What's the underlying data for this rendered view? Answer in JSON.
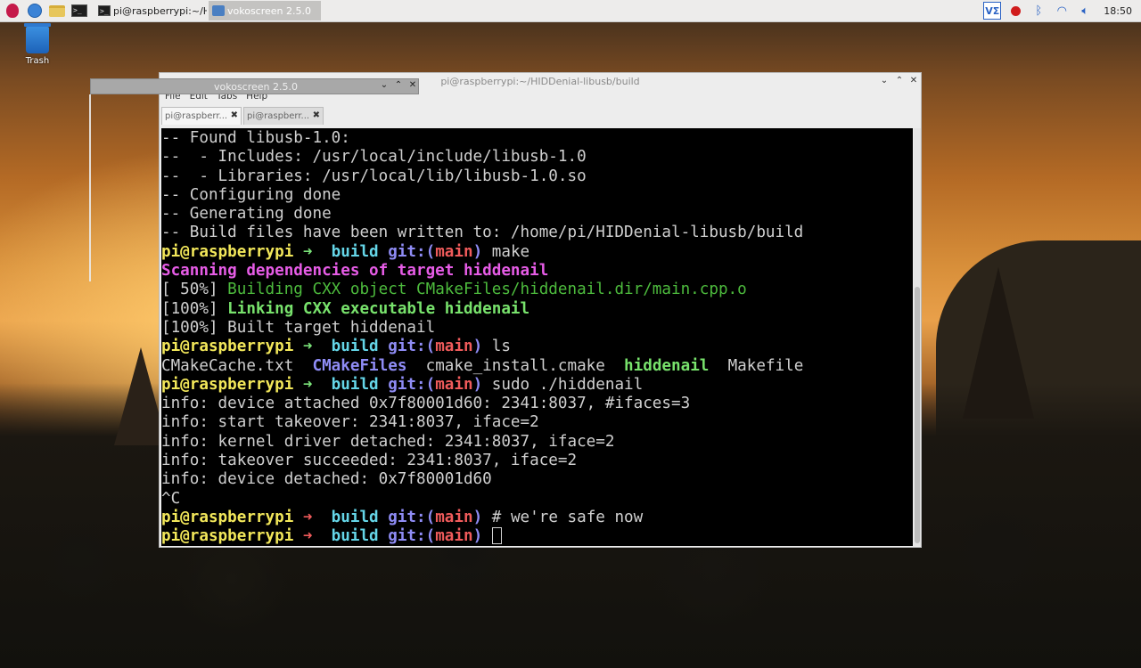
{
  "taskbar": {
    "tasks": [
      {
        "label": "pi@raspberrypi:~/HID"
      },
      {
        "label": "vokoscreen 2.5.0"
      }
    ],
    "tray": {
      "vnc_label": "VΣ",
      "clock": "18:50"
    }
  },
  "desktop": {
    "trash_label": "Trash"
  },
  "vokoscreen": {
    "title": "vokoscreen 2.5.0"
  },
  "terminal": {
    "title": "pi@raspberrypi:~/HIDDenial-libusb/build",
    "menu": [
      "File",
      "Edit",
      "Tabs",
      "Help"
    ],
    "tabs": [
      "pi@raspberr...",
      "pi@raspberr..."
    ],
    "lines": [
      [
        {
          "c": "",
          "t": "-- Found libusb-1.0:"
        }
      ],
      [
        {
          "c": "",
          "t": "--  - Includes: /usr/local/include/libusb-1.0"
        }
      ],
      [
        {
          "c": "",
          "t": "--  - Libraries: /usr/local/lib/libusb-1.0.so"
        }
      ],
      [
        {
          "c": "",
          "t": "-- Configuring done"
        }
      ],
      [
        {
          "c": "",
          "t": "-- Generating done"
        }
      ],
      [
        {
          "c": "",
          "t": "-- Build files have been written to: /home/pi/HIDDenial-libusb/build"
        }
      ],
      [
        {
          "c": "y",
          "t": "pi@raspberrypi"
        },
        {
          "c": "gr",
          "t": " ➜  "
        },
        {
          "c": "cy",
          "t": "build"
        },
        {
          "c": "",
          "t": " "
        },
        {
          "c": "bl",
          "t": "git:("
        },
        {
          "c": "rb",
          "t": "main"
        },
        {
          "c": "bl",
          "t": ")"
        },
        {
          "c": "cmd",
          "t": " make"
        }
      ],
      [
        {
          "c": "mg",
          "t": "Scanning dependencies of target hiddenail"
        }
      ],
      [
        {
          "c": "",
          "t": "[ 50%] "
        },
        {
          "c": "dg",
          "t": "Building CXX object CMakeFiles/hiddenail.dir/main.cpp.o"
        }
      ],
      [
        {
          "c": "",
          "t": "[100%] "
        },
        {
          "c": "lg",
          "t": "Linking CXX executable hiddenail"
        }
      ],
      [
        {
          "c": "",
          "t": "[100%] Built target hiddenail"
        }
      ],
      [
        {
          "c": "y",
          "t": "pi@raspberrypi"
        },
        {
          "c": "gr",
          "t": " ➜  "
        },
        {
          "c": "cy",
          "t": "build"
        },
        {
          "c": "",
          "t": " "
        },
        {
          "c": "bl",
          "t": "git:("
        },
        {
          "c": "rb",
          "t": "main"
        },
        {
          "c": "bl",
          "t": ")"
        },
        {
          "c": "cmd",
          "t": " ls"
        }
      ],
      [
        {
          "c": "",
          "t": "CMakeCache.txt  "
        },
        {
          "c": "bl",
          "t": "CMakeFiles"
        },
        {
          "c": "",
          "t": "  cmake_install.cmake  "
        },
        {
          "c": "lg",
          "t": "hiddenail"
        },
        {
          "c": "",
          "t": "  Makefile"
        }
      ],
      [
        {
          "c": "y",
          "t": "pi@raspberrypi"
        },
        {
          "c": "gr",
          "t": " ➜  "
        },
        {
          "c": "cy",
          "t": "build"
        },
        {
          "c": "",
          "t": " "
        },
        {
          "c": "bl",
          "t": "git:("
        },
        {
          "c": "rb",
          "t": "main"
        },
        {
          "c": "bl",
          "t": ")"
        },
        {
          "c": "cmd",
          "t": " sudo ./hiddenail"
        }
      ],
      [
        {
          "c": "",
          "t": "info: device attached 0x7f80001d60: 2341:8037, #ifaces=3"
        }
      ],
      [
        {
          "c": "",
          "t": "info: start takeover: 2341:8037, iface=2"
        }
      ],
      [
        {
          "c": "",
          "t": "info: kernel driver detached: 2341:8037, iface=2"
        }
      ],
      [
        {
          "c": "",
          "t": "info: takeover succeeded: 2341:8037, iface=2"
        }
      ],
      [
        {
          "c": "",
          "t": "info: device detached: 0x7f80001d60"
        }
      ],
      [
        {
          "c": "",
          "t": "^C"
        }
      ],
      [
        {
          "c": "y",
          "t": "pi@raspberrypi"
        },
        {
          "c": "rd",
          "t": " ➜  "
        },
        {
          "c": "cy",
          "t": "build"
        },
        {
          "c": "",
          "t": " "
        },
        {
          "c": "bl",
          "t": "git:("
        },
        {
          "c": "rb",
          "t": "main"
        },
        {
          "c": "bl",
          "t": ")"
        },
        {
          "c": "cmd",
          "t": " # we're safe now"
        }
      ],
      [
        {
          "c": "y",
          "t": "pi@raspberrypi"
        },
        {
          "c": "rd",
          "t": " ➜  "
        },
        {
          "c": "cy",
          "t": "build"
        },
        {
          "c": "",
          "t": " "
        },
        {
          "c": "bl",
          "t": "git:("
        },
        {
          "c": "rb",
          "t": "main"
        },
        {
          "c": "bl",
          "t": ")"
        },
        {
          "c": "cmd",
          "t": " "
        },
        {
          "c": "cursor",
          "t": ""
        }
      ]
    ]
  }
}
